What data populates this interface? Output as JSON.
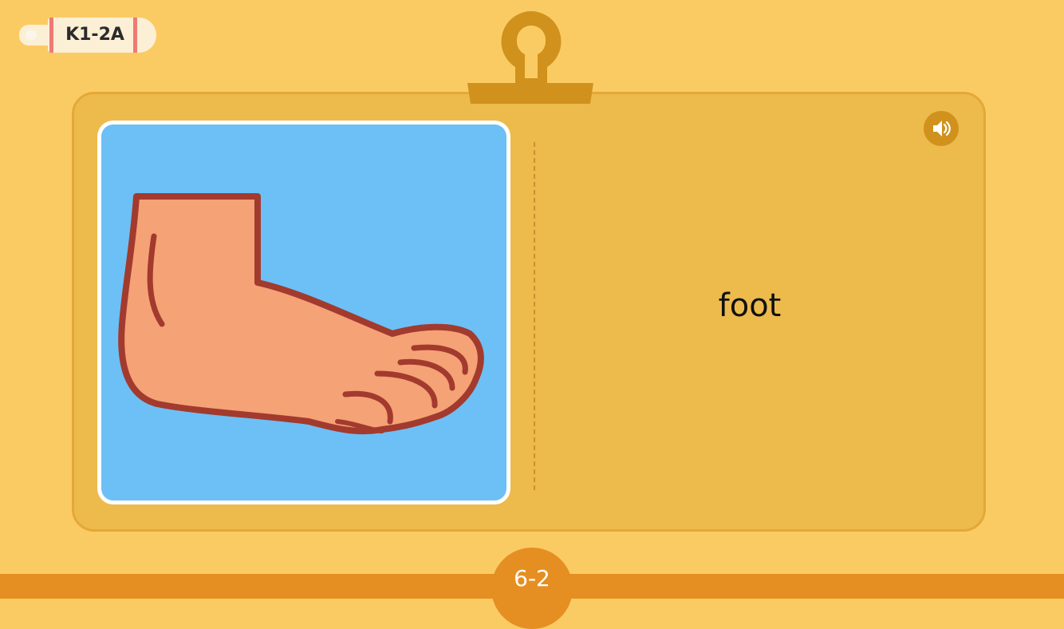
{
  "header": {
    "level_label": "K1-2A"
  },
  "card": {
    "image_icon": "foot-illustration",
    "word": "foot",
    "sound_icon": "speaker-icon"
  },
  "footer": {
    "page_label": "6-2"
  },
  "colors": {
    "background": "#FBCB63",
    "card": "#EDBA4C",
    "clip": "#D0921C",
    "bottom_bar": "#E58F23",
    "picture_bg": "#6CC0F5",
    "foot_fill": "#F4A276",
    "foot_outline": "#A33A2E"
  }
}
